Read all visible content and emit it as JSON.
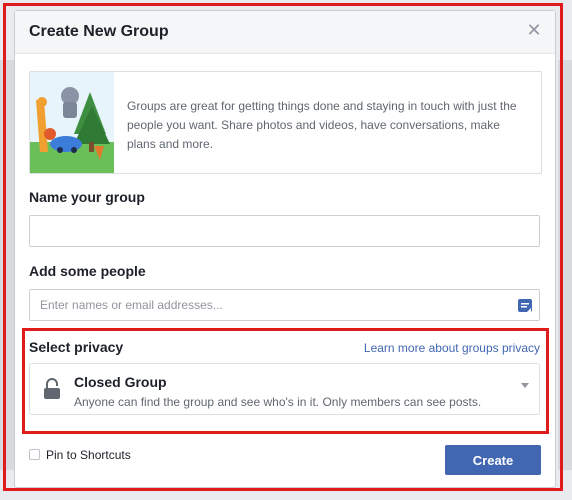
{
  "dialog": {
    "title": "Create New Group",
    "intro_text": "Groups are great for getting things done and staying in touch with just the people you want. Share photos and videos, have conversations, make plans and more."
  },
  "name_group": {
    "label": "Name your group",
    "value": "",
    "placeholder": ""
  },
  "add_people": {
    "label": "Add some people",
    "placeholder": "Enter names or email addresses..."
  },
  "privacy": {
    "label": "Select privacy",
    "learn_link": "Learn more about groups privacy",
    "selected_option": {
      "name": "Closed Group",
      "description": "Anyone can find the group and see who's in it. Only members can see posts."
    }
  },
  "footer": {
    "pin_label": "Pin to Shortcuts",
    "pin_checked": false,
    "create_label": "Create"
  },
  "icons": {
    "close": "close-icon",
    "picker": "contact-picker-icon",
    "lock": "lock-icon",
    "dropdown": "chevron-down-icon"
  },
  "colors": {
    "accent": "#4267b2",
    "highlight_border": "#e01b1b",
    "header_bg": "#f5f6f7"
  }
}
